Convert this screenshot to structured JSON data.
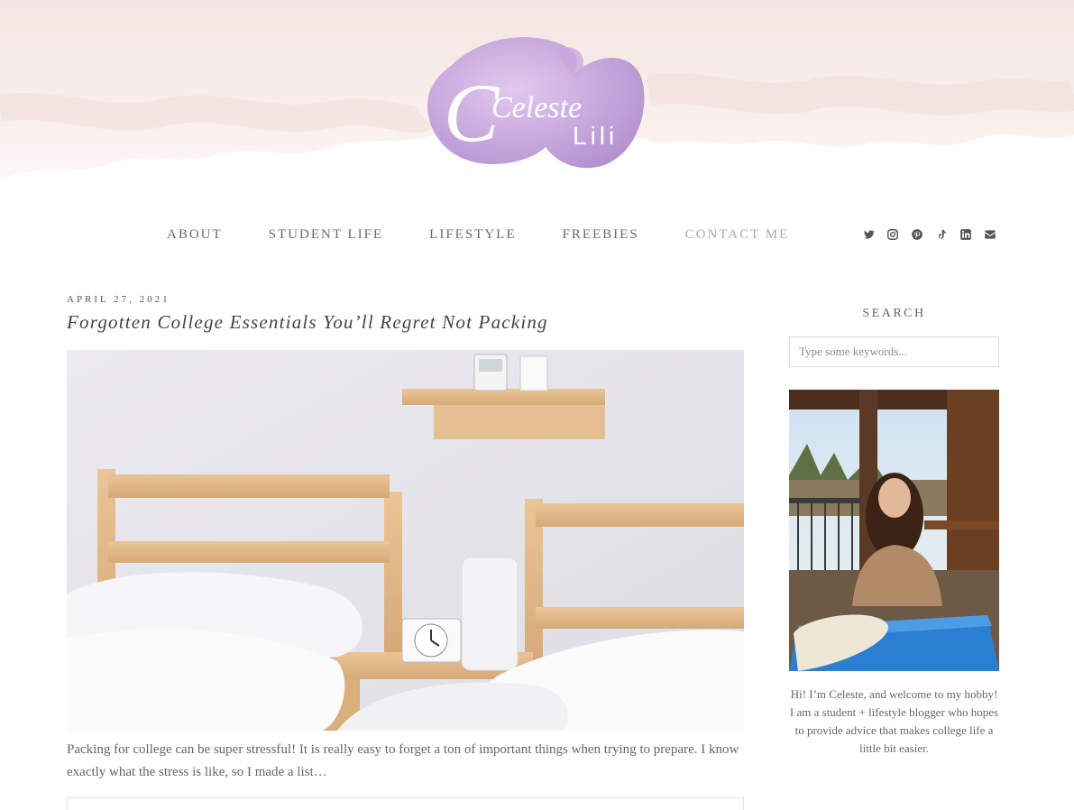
{
  "logo": {
    "text_main": "Celeste",
    "text_secondary": "Lili"
  },
  "nav": {
    "items": [
      {
        "label": "ABOUT"
      },
      {
        "label": "STUDENT LIFE"
      },
      {
        "label": "LIFESTYLE"
      },
      {
        "label": "FREEBIES"
      },
      {
        "label": "CONTACT ME"
      }
    ]
  },
  "social": {
    "icons": [
      "twitter-icon",
      "instagram-icon",
      "pinterest-icon",
      "tiktok-icon",
      "linkedin-icon",
      "email-icon"
    ]
  },
  "post": {
    "date": "APRIL 27, 2021",
    "title": "Forgotten College Essentials You’ll Regret Not Packing",
    "excerpt": "Packing for college can be super stressful! It is really easy to forget a ton of important things when trying to prepare. I know exactly what the stress is like, so I made a list…"
  },
  "sidebar": {
    "search_title": "SEARCH",
    "search_placeholder": "Type some keywords...",
    "bio": "Hi! I’m Celeste, and welcome to my hobby! I am a student + lifestyle blogger who hopes to provide advice that makes college life a little bit easier."
  },
  "colors": {
    "logo_purple": "#b79ad6",
    "header_wash": "#f6e9e6",
    "text": "#666666"
  }
}
